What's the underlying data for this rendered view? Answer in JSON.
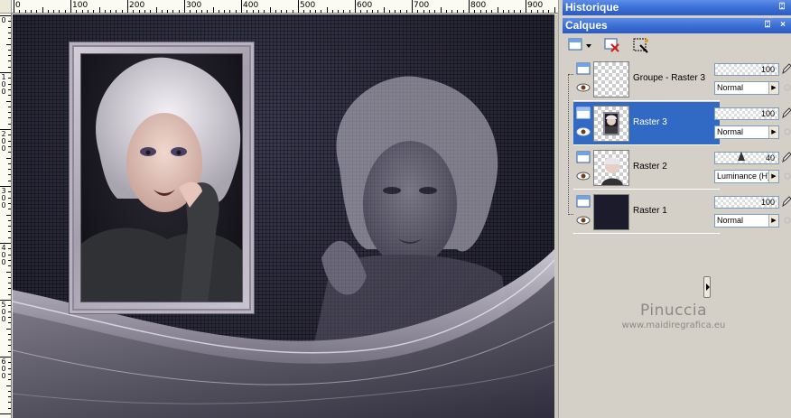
{
  "ruler_top": {
    "labels": [
      "0",
      "100",
      "200",
      "300",
      "400",
      "500",
      "600",
      "700",
      "800",
      "900"
    ]
  },
  "ruler_left": {
    "labels": [
      "0",
      "1\n0\n0",
      "2\n0\n0",
      "3\n0\n0",
      "4\n0\n0",
      "5\n0\n0",
      "6\n0\n0"
    ]
  },
  "panels": {
    "historique": {
      "title": "Historique",
      "pin": "⍠"
    },
    "calques": {
      "title": "Calques",
      "pin": "⍠",
      "close": "×"
    }
  },
  "layers": [
    {
      "name": "Groupe - Raster 3",
      "opacity": "100",
      "blend_mode": "Normal",
      "selected": false,
      "thumb": "transparent"
    },
    {
      "name": "Raster 3",
      "opacity": "100",
      "blend_mode": "Normal",
      "selected": true,
      "thumb": "portrait-small"
    },
    {
      "name": "Raster 2",
      "opacity": "40",
      "blend_mode": "Luminance (H)",
      "selected": false,
      "thumb": "portrait"
    },
    {
      "name": "Raster 1",
      "opacity": "100",
      "blend_mode": "Normal",
      "selected": false,
      "thumb": "dark"
    }
  ],
  "watermark": {
    "name": "Pinuccia",
    "url": "www.maidiregrafica.eu"
  },
  "colors": {
    "title_bar": "#3b6fd6",
    "selection": "#316ac5",
    "canvas_bg": "#262538",
    "frame": "#b9b3c1"
  },
  "icons": {
    "new_layer": "new-layer-icon",
    "delete_layer": "delete-layer-icon",
    "mask": "mask-icon",
    "visibility": "eye-icon",
    "edit": "pencil-icon"
  }
}
